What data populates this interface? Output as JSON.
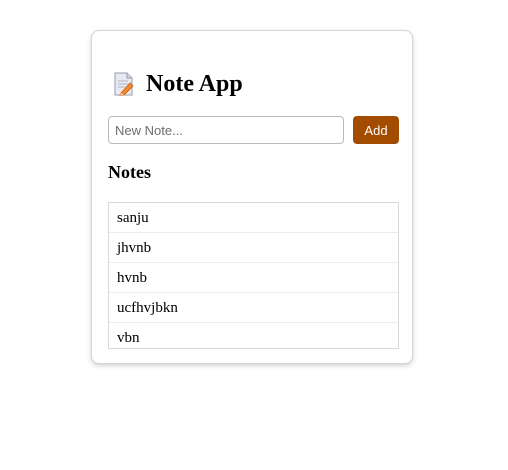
{
  "app": {
    "title": "Note App",
    "icon": "memo-icon"
  },
  "input": {
    "placeholder": "New Note...",
    "value": ""
  },
  "add_button": {
    "label": "Add"
  },
  "notes_section": {
    "heading": "Notes",
    "items": [
      "sanju",
      "jhvnb",
      "hvnb",
      "ucfhvjbkn",
      "vbn"
    ]
  },
  "colors": {
    "accent": "#a34c00",
    "border": "#d6d6d6"
  }
}
